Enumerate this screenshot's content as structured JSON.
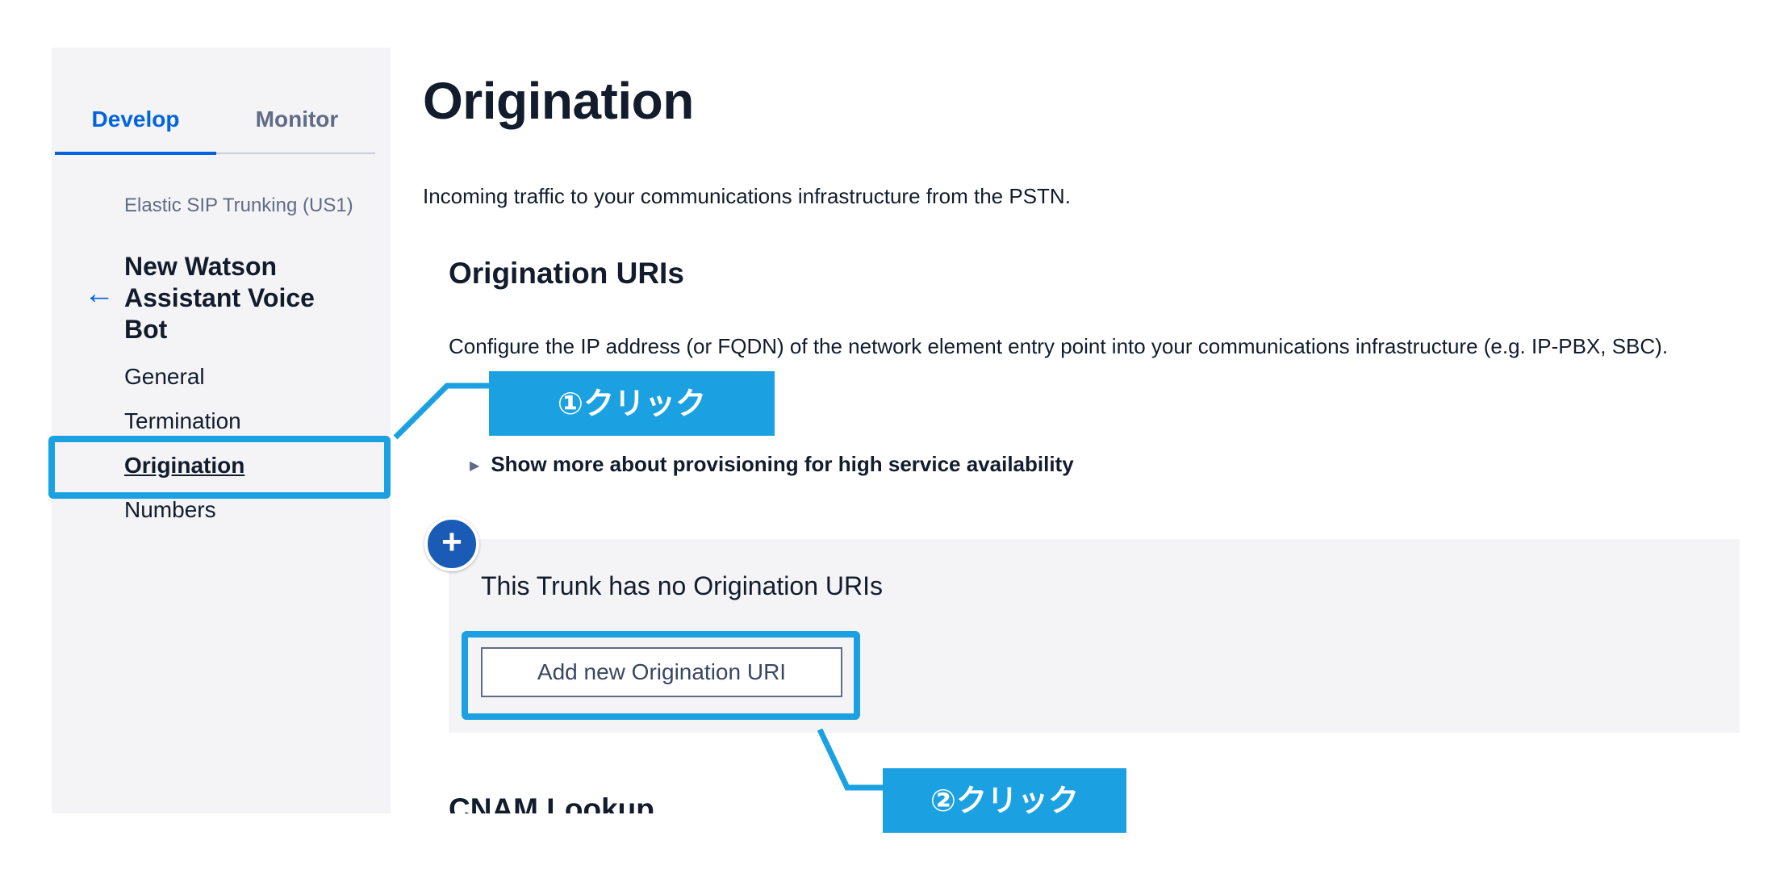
{
  "sidebar": {
    "tabs": [
      {
        "label": "Develop",
        "active": true
      },
      {
        "label": "Monitor",
        "active": false
      }
    ],
    "breadcrumb_parent": "Elastic SIP Trunking (US1)",
    "back_icon": "arrow-left-icon",
    "trunk_name": "New Watson Assistant Voice Bot",
    "nav": {
      "general": "General",
      "termination": "Termination",
      "origination": "Origination",
      "numbers": "Numbers"
    },
    "active_item": "Origination"
  },
  "main": {
    "title": "Origination",
    "description": "Incoming traffic to your communications infrastructure from the PSTN.",
    "origination_uris": {
      "title": "Origination URIs",
      "description": "Configure the IP address (or FQDN) of the network element entry point into your communications infrastructure (e.g. IP-PBX, SBC).",
      "disclosure_label": "Show more about provisioning for high service availability",
      "empty_text": "This Trunk has no Origination URIs",
      "add_button_label": "Add new Origination URI"
    },
    "cnam": {
      "title": "CNAM Lookup"
    }
  },
  "annotations": {
    "callout_1": "①クリック",
    "callout_2": "②クリック",
    "accent_color": "#1ba1e2"
  },
  "colors": {
    "brand_blue": "#0263e0",
    "text": "#121c2d",
    "sidebar_bg": "#f4f4f6"
  }
}
